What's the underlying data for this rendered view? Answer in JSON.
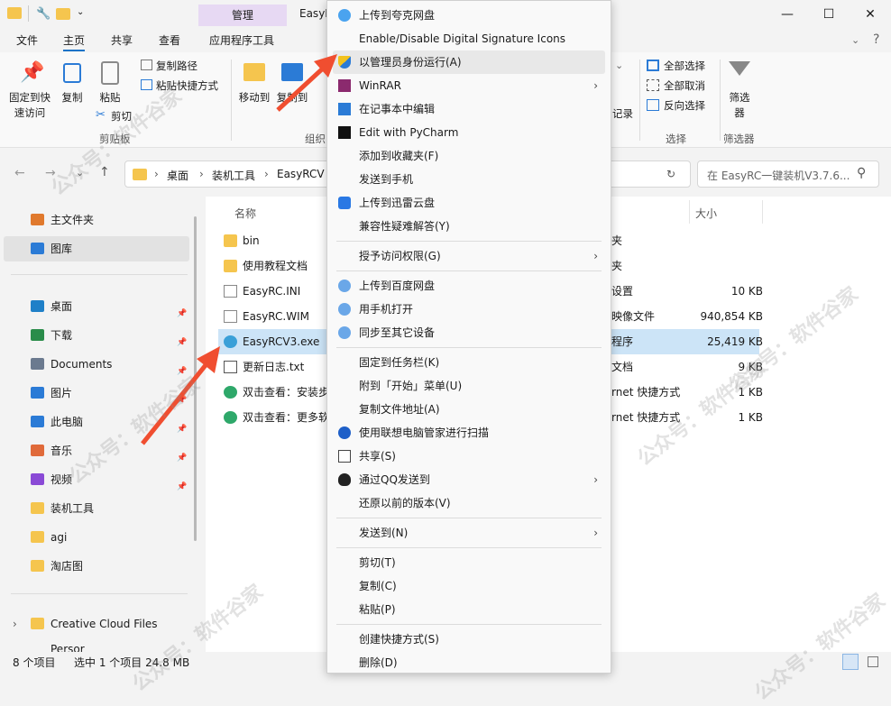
{
  "window": {
    "title": "EasyRC",
    "manage_tab": "管理"
  },
  "ribbon_tabs": [
    "文件",
    "主页",
    "共享",
    "查看",
    "应用程序工具"
  ],
  "ribbon": {
    "pin_quick": [
      "固定到快",
      "速访问"
    ],
    "copy": "复制",
    "paste": "粘贴",
    "copy_path": "复制路径",
    "paste_shortcut": "粘贴快捷方式",
    "cut": "剪切",
    "clipboard_group": "剪贴板",
    "move_to": "移动到",
    "copy_to": "复制到",
    "organize_group": "组织",
    "history_partial": "记录",
    "select_all": "全部选择",
    "select_none": "全部取消",
    "invert_select": "反向选择",
    "select_group": "选择",
    "filter": "筛选器",
    "filter_label": [
      "筛选",
      "器"
    ],
    "filter_group": "筛选器"
  },
  "address": {
    "crumbs": [
      "桌面",
      "装机工具",
      "EasyRCV"
    ],
    "search_placeholder": "在 EasyRC一键装机V3.7.6..."
  },
  "nav": {
    "items": [
      {
        "label": "主文件夹",
        "icon": "home-icon"
      },
      {
        "label": "图库",
        "icon": "gallery-icon",
        "selected": true
      },
      {
        "label": "桌面",
        "icon": "desktop-icon",
        "pinned": true
      },
      {
        "label": "下载",
        "icon": "download-icon",
        "pinned": true
      },
      {
        "label": "Documents",
        "icon": "documents-icon",
        "pinned": true
      },
      {
        "label": "图片",
        "icon": "pictures-icon",
        "pinned": true
      },
      {
        "label": "此电脑",
        "icon": "computer-icon",
        "pinned": true
      },
      {
        "label": "音乐",
        "icon": "music-icon",
        "pinned": true
      },
      {
        "label": "视频",
        "icon": "video-icon",
        "pinned": true
      },
      {
        "label": "装机工具",
        "icon": "folder-icon"
      },
      {
        "label": "agi",
        "icon": "folder-icon"
      },
      {
        "label": "淘店图",
        "icon": "folder-icon"
      },
      {
        "label": "Creative Cloud Files Persor",
        "icon": "folder-icon"
      }
    ]
  },
  "files": {
    "col_name": "名称",
    "col_size": "大小",
    "rows": [
      {
        "name": "bin",
        "icon": "folder-icon",
        "type": "夹",
        "size": ""
      },
      {
        "name": "使用教程文档",
        "icon": "folder-icon",
        "type": "夹",
        "size": ""
      },
      {
        "name": "EasyRC.INI",
        "icon": "ini-file-icon",
        "type": "设置",
        "size": "10 KB"
      },
      {
        "name": "EasyRC.WIM",
        "icon": "file-icon",
        "type": "映像文件",
        "size": "940,854 KB"
      },
      {
        "name": "EasyRCV3.exe",
        "icon": "exe-icon",
        "type": "程序",
        "size": "25,419 KB",
        "selected": true
      },
      {
        "name": "更新日志.txt",
        "icon": "txt-icon",
        "type": "文档",
        "size": "9 KB"
      },
      {
        "name": "双击查看：安装步",
        "icon": "edge-icon",
        "type": "rnet 快捷方式",
        "size": "1 KB"
      },
      {
        "name": "双击查看：更多软",
        "icon": "edge-icon",
        "type": "rnet 快捷方式",
        "size": "1 KB"
      }
    ]
  },
  "status": {
    "count": "8 个项目",
    "selected": "选中 1 个项目  24.8 MB"
  },
  "menu": {
    "items": [
      {
        "label": "上传到夸克网盘",
        "icon": "quark-cloud-icon"
      },
      {
        "label": "Enable/Disable Digital Signature Icons",
        "icon": ""
      },
      {
        "label": "以管理员身份运行(A)",
        "icon": "shield-icon",
        "highlight": true
      },
      {
        "label": "WinRAR",
        "icon": "winrar-icon",
        "submenu": true
      },
      {
        "label": "在记事本中编辑",
        "icon": "notepad-icon"
      },
      {
        "label": "Edit with PyCharm",
        "icon": "pycharm-icon"
      },
      {
        "label": "添加到收藏夹(F)",
        "icon": ""
      },
      {
        "label": "发送到手机",
        "icon": ""
      },
      {
        "label": "上传到迅雷云盘",
        "icon": "xunlei-icon"
      },
      {
        "label": "兼容性疑难解答(Y)",
        "icon": ""
      },
      {
        "label": "授予访问权限(G)",
        "icon": "",
        "submenu": true,
        "sep_before": true
      },
      {
        "label": "上传到百度网盘",
        "icon": "baidu-cloud-icon",
        "sep_before": true
      },
      {
        "label": "用手机打开",
        "icon": "baidu-cloud-icon"
      },
      {
        "label": "同步至其它设备",
        "icon": "baidu-cloud-icon"
      },
      {
        "label": "固定到任务栏(K)",
        "icon": "",
        "sep_before": true
      },
      {
        "label": "附到「开始」菜单(U)",
        "icon": ""
      },
      {
        "label": "复制文件地址(A)",
        "icon": ""
      },
      {
        "label": "使用联想电脑管家进行扫描",
        "icon": "lenovo-icon"
      },
      {
        "label": "共享(S)",
        "icon": "share-icon"
      },
      {
        "label": "通过QQ发送到",
        "icon": "qq-icon",
        "submenu": true
      },
      {
        "label": "还原以前的版本(V)",
        "icon": ""
      },
      {
        "label": "发送到(N)",
        "icon": "",
        "submenu": true,
        "sep_before": true
      },
      {
        "label": "剪切(T)",
        "icon": "",
        "sep_before": true
      },
      {
        "label": "复制(C)",
        "icon": ""
      },
      {
        "label": "粘贴(P)",
        "icon": ""
      },
      {
        "label": "创建快捷方式(S)",
        "icon": "",
        "sep_before": true
      },
      {
        "label": "删除(D)",
        "icon": ""
      }
    ]
  },
  "watermark": "公众号：软件谷家"
}
